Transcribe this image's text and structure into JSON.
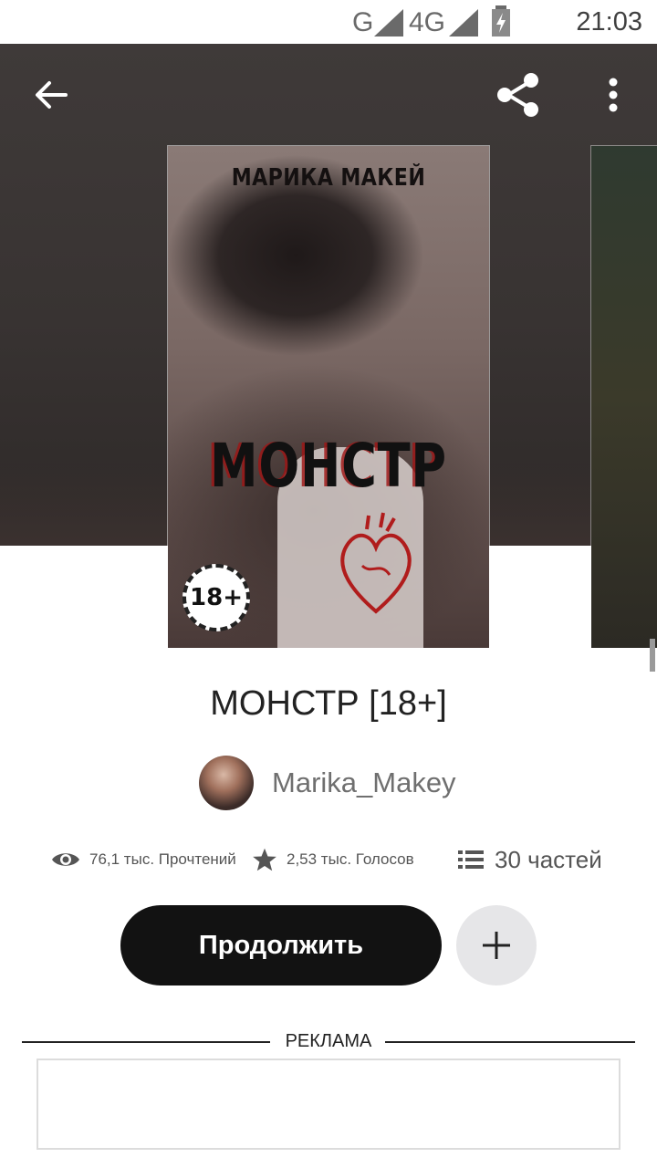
{
  "status_bar": {
    "network_1": "G",
    "network_2": "4G",
    "time": "21:03"
  },
  "toolbar": {
    "back_icon": "arrow-left-icon",
    "share_icon": "share-icon",
    "more_icon": "more-vertical-icon"
  },
  "cover": {
    "author_text": "МАРИКА МАКЕЙ",
    "title_text": "МОНСТР",
    "age_badge": "18+"
  },
  "book": {
    "title": "МОНСТР [18+]",
    "author": "Marika_Makey"
  },
  "stats": {
    "reads": "76,1 тыс. Прочтений",
    "votes": "2,53 тыс. Голосов",
    "parts": "30 частей"
  },
  "actions": {
    "continue_label": "Продолжить"
  },
  "ad": {
    "label": "РЕКЛАМА"
  },
  "colors": {
    "primary_button": "#121212",
    "secondary_button": "#e6e6e8",
    "header_bg": "#3a3534"
  }
}
